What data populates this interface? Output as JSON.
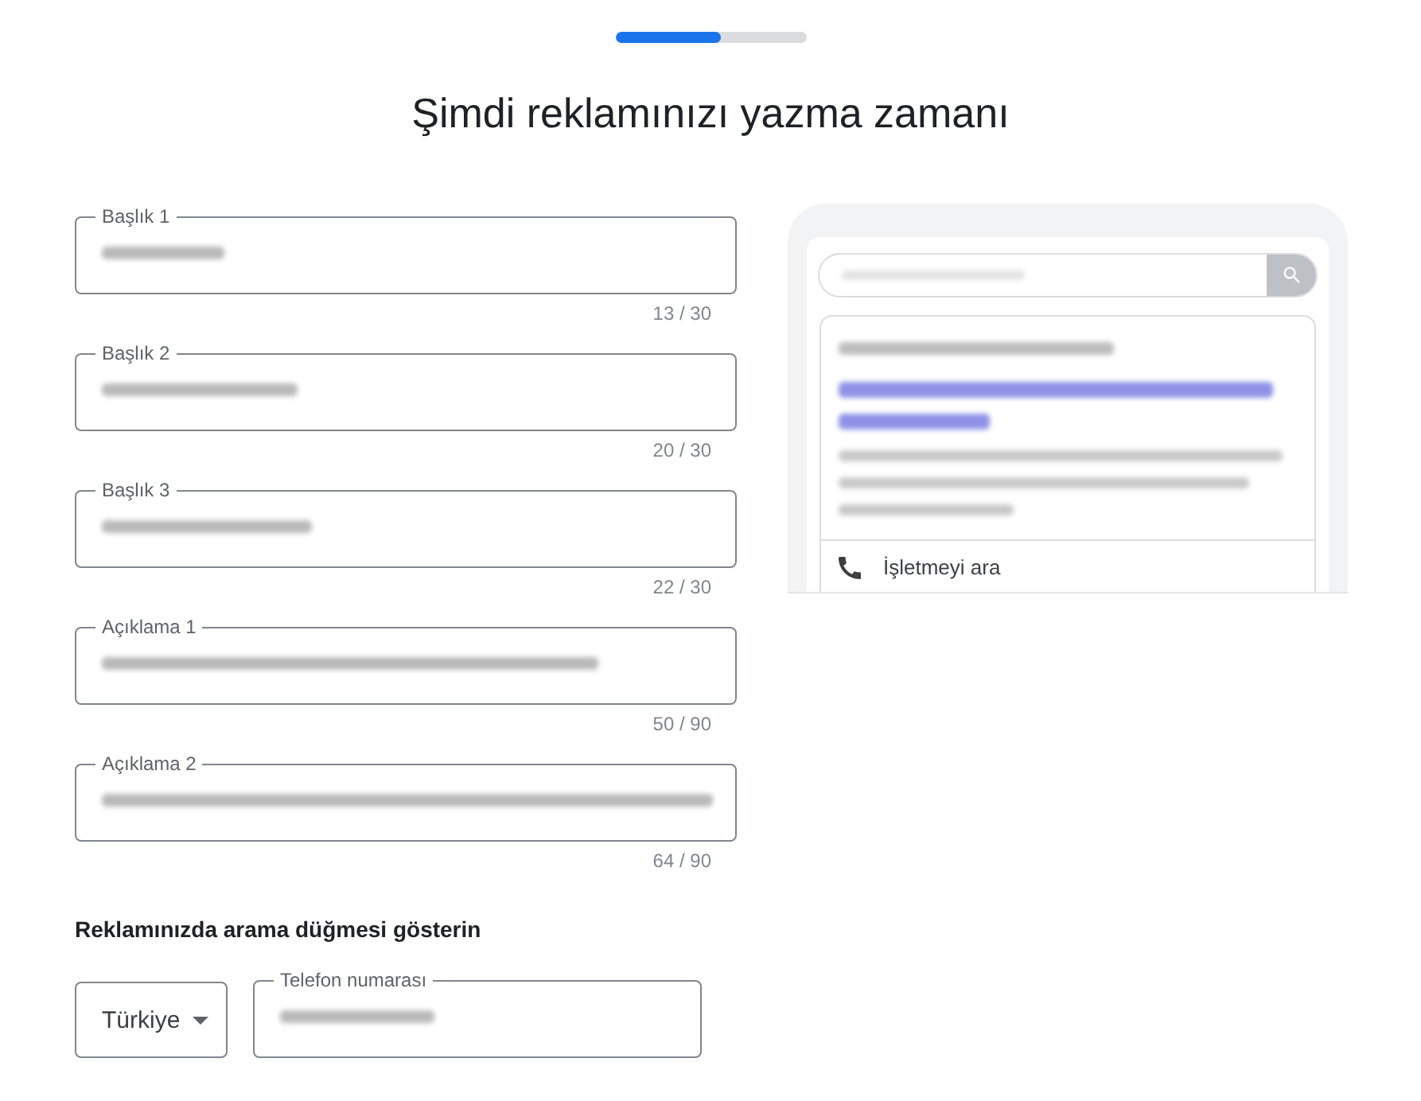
{
  "progress": {
    "level": 0.55
  },
  "title": "Şimdi reklamınızı yazma zamanı",
  "fields": [
    {
      "label": "Başlık 1",
      "value_blurred": true,
      "counter": "13 / 30"
    },
    {
      "label": "Başlık 2",
      "value_blurred": true,
      "counter": "20 / 30"
    },
    {
      "label": "Başlık 3",
      "value_blurred": true,
      "counter": "22 / 30"
    },
    {
      "label": "Açıklama 1",
      "value_blurred": true,
      "counter": "50 / 90"
    },
    {
      "label": "Açıklama 2",
      "value_blurred": true,
      "counter": "64 / 90"
    }
  ],
  "call_section": {
    "heading": "Reklamınızda arama düğmesi gösterin",
    "country": "Türkiye",
    "phone": {
      "label": "Telefon numarası",
      "value_blurred": true
    }
  },
  "preview": {
    "search_query_blurred": true,
    "ad_text_blurred": true,
    "call_label": "İşletmeyi ara"
  }
}
